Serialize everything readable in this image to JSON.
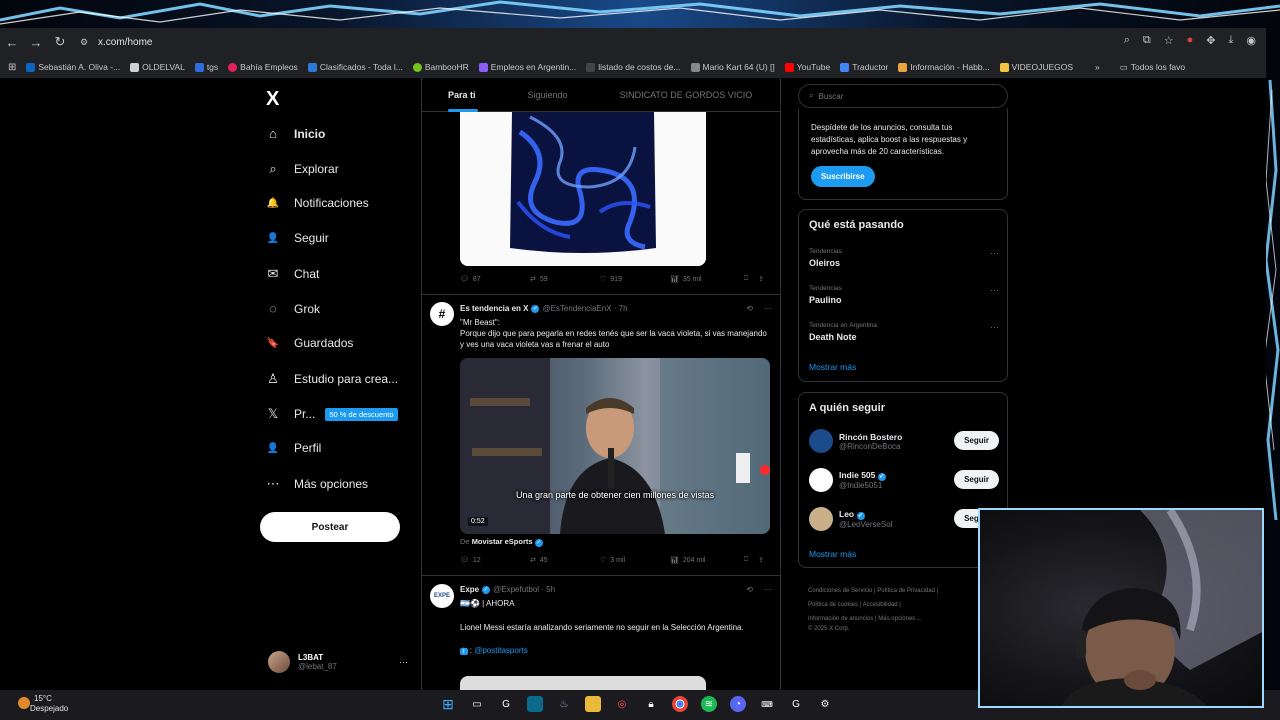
{
  "browser": {
    "url": "x.com/home",
    "bookmarks": [
      {
        "label": "Sebastián A. Oliva -...",
        "color": "#0a66c2"
      },
      {
        "label": "OLDELVAL",
        "color": "#d0d0d0"
      },
      {
        "label": "tgs",
        "color": "#2d6cdf"
      },
      {
        "label": "Bahía Empleos",
        "color": "#e2245b"
      },
      {
        "label": "Clasificados - Toda l...",
        "color": "#2b7bd6"
      },
      {
        "label": "BambooHR",
        "color": "#73c41d"
      },
      {
        "label": "Empleos en Argentin...",
        "color": "#8b5cf6"
      },
      {
        "label": "listado de costos de...",
        "color": "#444"
      },
      {
        "label": "Mario Kart 64 (U) []",
        "color": "#888"
      },
      {
        "label": "YouTube",
        "color": "#ff0000"
      },
      {
        "label": "Traductor",
        "color": "#4285f4"
      },
      {
        "label": "Información - Habb...",
        "color": "#e8a33d"
      },
      {
        "label": "VIDEOJUEGOS",
        "color": "#f4c542"
      }
    ],
    "bookmarks_right": "Todos los favo"
  },
  "sidebar": {
    "logo": "X",
    "items": [
      {
        "label": "Inicio",
        "icon": "⌂",
        "active": true
      },
      {
        "label": "Explorar",
        "icon": "⌕",
        "active": false
      },
      {
        "label": "Notificaciones",
        "icon": "🔔",
        "active": false
      },
      {
        "label": "Seguir",
        "icon": "👤",
        "active": false
      },
      {
        "label": "Chat",
        "icon": "✉",
        "active": false
      },
      {
        "label": "Grok",
        "icon": "◌",
        "active": false
      },
      {
        "label": "Guardados",
        "icon": "🔖",
        "active": false
      },
      {
        "label": "Estudio para crea...",
        "icon": "♙",
        "active": false
      },
      {
        "label": "Pr...",
        "icon": "𝕏",
        "active": false
      },
      {
        "label": "Perfil",
        "icon": "👤",
        "active": false
      },
      {
        "label": "Más opciones",
        "icon": "⋯",
        "active": false
      }
    ],
    "promo_badge": "50 % de descuento",
    "post_button": "Postear",
    "profile_name": "L3BAT",
    "profile_handle": "@lebat_87",
    "profile_more": "···"
  },
  "feed": {
    "tabs": [
      "Para ti",
      "Siguiendo",
      "SINDICATO DE GORDOS VICIO"
    ],
    "post1_actions": {
      "replies": "87",
      "reposts": "59",
      "likes": "919",
      "views": "35 mil"
    },
    "post2": {
      "name": "Es tendencia en X",
      "handle": "@EsTendenciaEnX · 7h",
      "avatar": "#",
      "text1": "\"Mr Beast\":",
      "text2": "Porque dijo que para pegarla en redes tenés que ser la vaca violeta, si vas manejando y ves una vaca violeta vas a frenar el auto",
      "video_caption": "Una gran parte de obtener cien millones de vistas",
      "video_duration": "0:52",
      "from_prefix": "De",
      "from_name": "Movistar eSports",
      "actions": {
        "replies": "12",
        "reposts": "45",
        "likes": "3 mil",
        "views": "204 mil"
      }
    },
    "post3": {
      "name": "Expe",
      "handle": "@Expefutbol · 5h",
      "tag": "🇦🇷⚽ | AHORA",
      "text": "Lionel Messi estaría analizando seriamente no seguir en la Selección Argentina.",
      "source": "@postitasports"
    }
  },
  "right": {
    "search_placeholder": "Buscar",
    "premium_text": "Despídete de los anuncios, consulta tus estadísticas, aplica boost a las respuestas y aprovecha más de 20 características.",
    "subscribe": "Suscribirse",
    "trends_title": "Qué está pasando",
    "trends": [
      {
        "context": "Tendencias",
        "name": "Oleiros"
      },
      {
        "context": "Tendencias",
        "name": "Paulino"
      },
      {
        "context": "Tendencia en Argentina",
        "name": "Death Note"
      }
    ],
    "trends_more": "Mostrar más",
    "follow_title": "A quién seguir",
    "follow": [
      {
        "name": "Rincón Bostero",
        "handle": "@RinconDeBoca",
        "verified": false,
        "color": "#1b4b8a"
      },
      {
        "name": "Indie 505",
        "handle": "@Indie5051",
        "verified": true,
        "color": "#ffffff"
      },
      {
        "name": "Leo",
        "handle": "@LeoVerseSol",
        "verified": true,
        "color": "#c9b08a"
      }
    ],
    "follow_button": "Seguir",
    "follow_more": "Mostrar más",
    "footer_links": [
      "Condiciones de Servicio",
      "Política de Privacidad",
      "Política de cookies",
      "Accesibilidad",
      "Información de anuncios",
      "Más opciones ...",
      "© 2025 X Corp."
    ]
  },
  "taskbar": {
    "temp": "15°C",
    "weather": "Despejado"
  }
}
